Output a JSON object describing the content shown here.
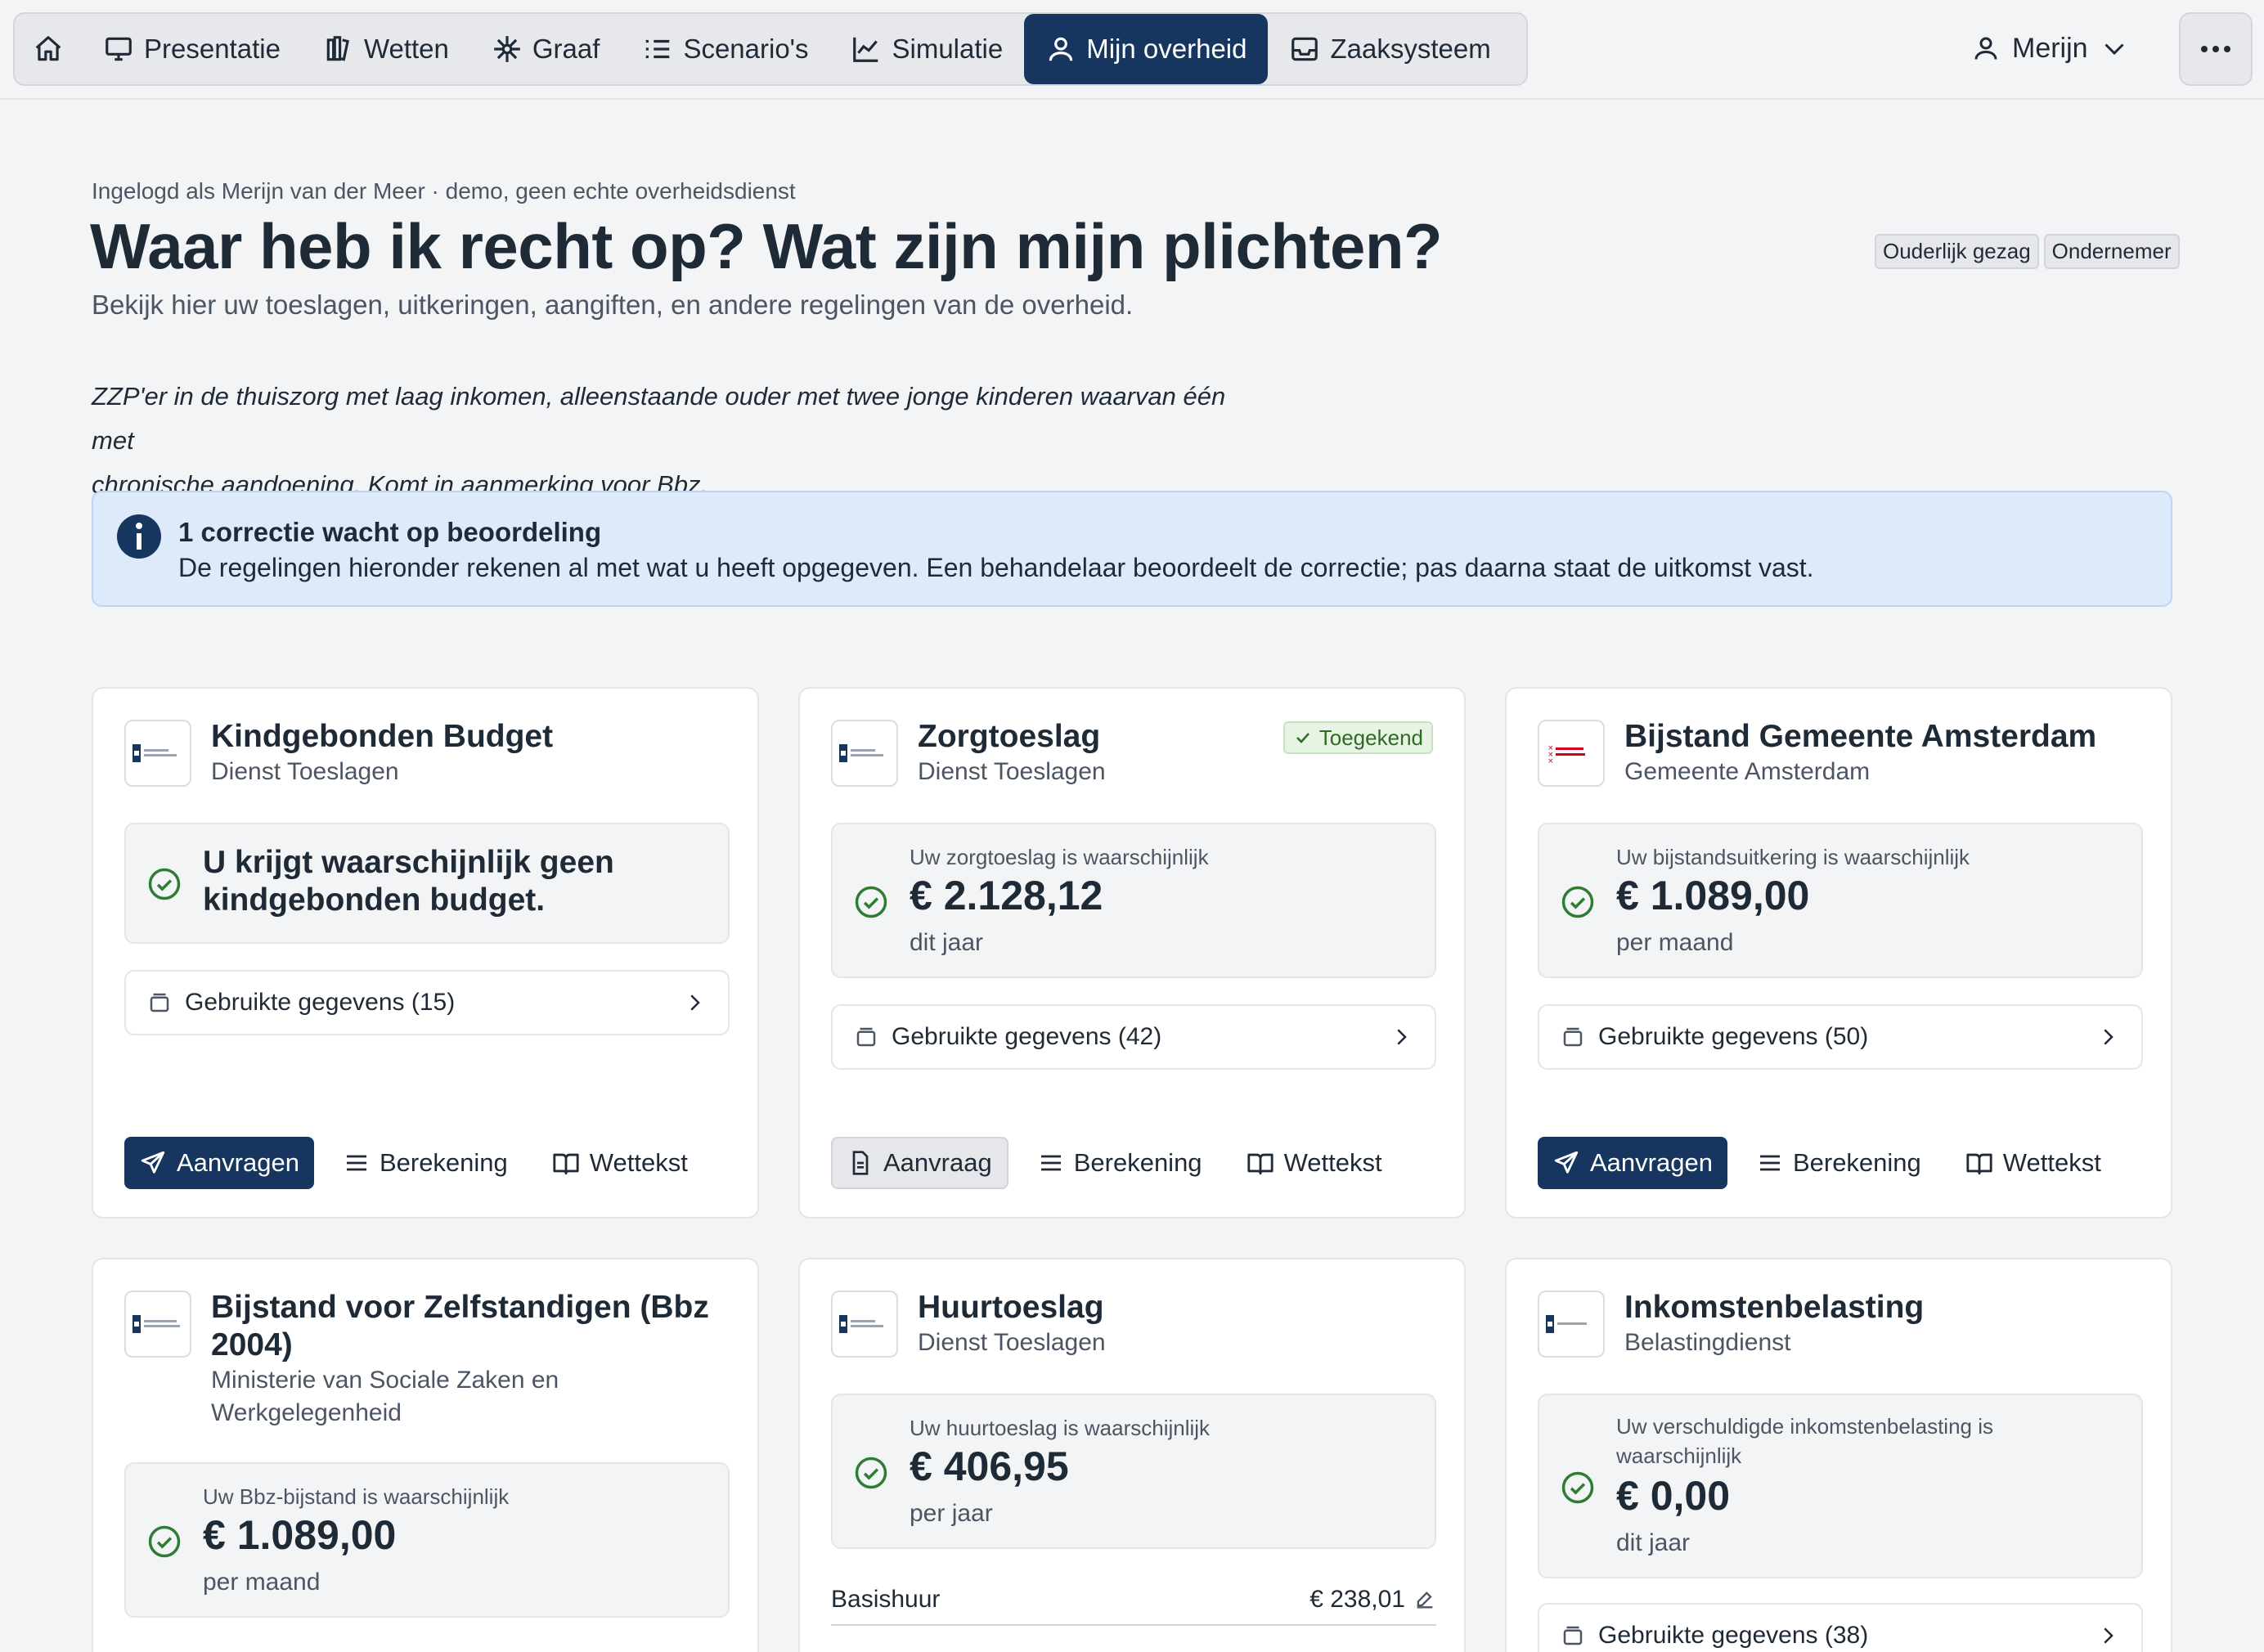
{
  "nav": {
    "items": [
      {
        "label": "Presentatie",
        "icon": "monitor-icon"
      },
      {
        "label": "Wetten",
        "icon": "books-icon"
      },
      {
        "label": "Graaf",
        "icon": "graph-icon"
      },
      {
        "label": "Scenario's",
        "icon": "list-check-icon"
      },
      {
        "label": "Simulatie",
        "icon": "line-chart-icon"
      },
      {
        "label": "Mijn overheid",
        "icon": "user-icon"
      },
      {
        "label": "Zaaksysteem",
        "icon": "inbox-icon"
      }
    ],
    "active": "Mijn overheid",
    "user": "Merijn",
    "accent": "#17365f"
  },
  "header": {
    "logged_in": "Ingelogd als Merijn van der Meer · demo, geen echte overheidsdienst",
    "title": "Waar heb ik recht op? Wat zijn mijn plichten?",
    "subtitle": "Bekijk hier uw toeslagen, uitkeringen, aangiften, en andere regelingen van de overheid.",
    "tags": [
      "Ouderlijk gezag",
      "Ondernemer"
    ],
    "persona_line1": "ZZP'er in de thuiszorg met laag inkomen, alleenstaande ouder met twee jonge kinderen waarvan één met",
    "persona_line2": "chronische aandoening. Komt in aanmerking voor Bbz."
  },
  "alert": {
    "title": "1 correctie wacht op beoordeling",
    "text": "De regelingen hieronder rekenen al met wat u heeft opgegeven. Een behandelaar beoordeelt de correctie; pas daarna staat de uitkomst vast."
  },
  "cards": [
    {
      "title": "Kindgebonden Budget",
      "org": "Dienst Toeslagen",
      "result_text": "U krijgt waarschijnlijk geen kindgebonden budget.",
      "gegevens": "Gebruikte gegevens (15)",
      "primary": "Aanvragen",
      "berekening": "Berekening",
      "wettekst": "Wettekst"
    },
    {
      "title": "Zorgtoeslag",
      "org": "Dienst Toeslagen",
      "badge": "Toegekend",
      "result_label": "Uw zorgtoeslag is waarschijnlijk",
      "amount": "€ 2.128,12",
      "period": "dit jaar",
      "gegevens": "Gebruikte gegevens (42)",
      "secondary": "Aanvraag",
      "berekening": "Berekening",
      "wettekst": "Wettekst"
    },
    {
      "title": "Bijstand Gemeente Amsterdam",
      "org": "Gemeente Amsterdam",
      "result_label": "Uw bijstandsuitkering is waarschijnlijk",
      "amount": "€ 1.089,00",
      "period": "per maand",
      "gegevens": "Gebruikte gegevens (50)",
      "primary": "Aanvragen",
      "berekening": "Berekening",
      "wettekst": "Wettekst"
    },
    {
      "title": "Bijstand voor Zelfstandigen (Bbz 2004)",
      "org": "Ministerie van Sociale Zaken en Werkgelegenheid",
      "result_label": "Uw Bbz-bijstand is waarschijnlijk",
      "amount": "€ 1.089,00",
      "period": "per maand"
    },
    {
      "title": "Huurtoeslag",
      "org": "Dienst Toeslagen",
      "result_label": "Uw huurtoeslag is waarschijnlijk",
      "amount": "€ 406,95",
      "period": "per jaar",
      "row_label": "Basishuur",
      "row_value": "€ 238,01"
    },
    {
      "title": "Inkomstenbelasting",
      "org": "Belastingdienst",
      "result_label": "Uw verschuldigde inkomstenbelasting is waarschijnlijk",
      "amount": "€ 0,00",
      "period": "dit jaar",
      "gegevens": "Gebruikte gegevens (38)"
    }
  ],
  "colors": {
    "success": "#2f7d32",
    "alert_bg": "#dceafa",
    "info_icon": "#17365f"
  }
}
